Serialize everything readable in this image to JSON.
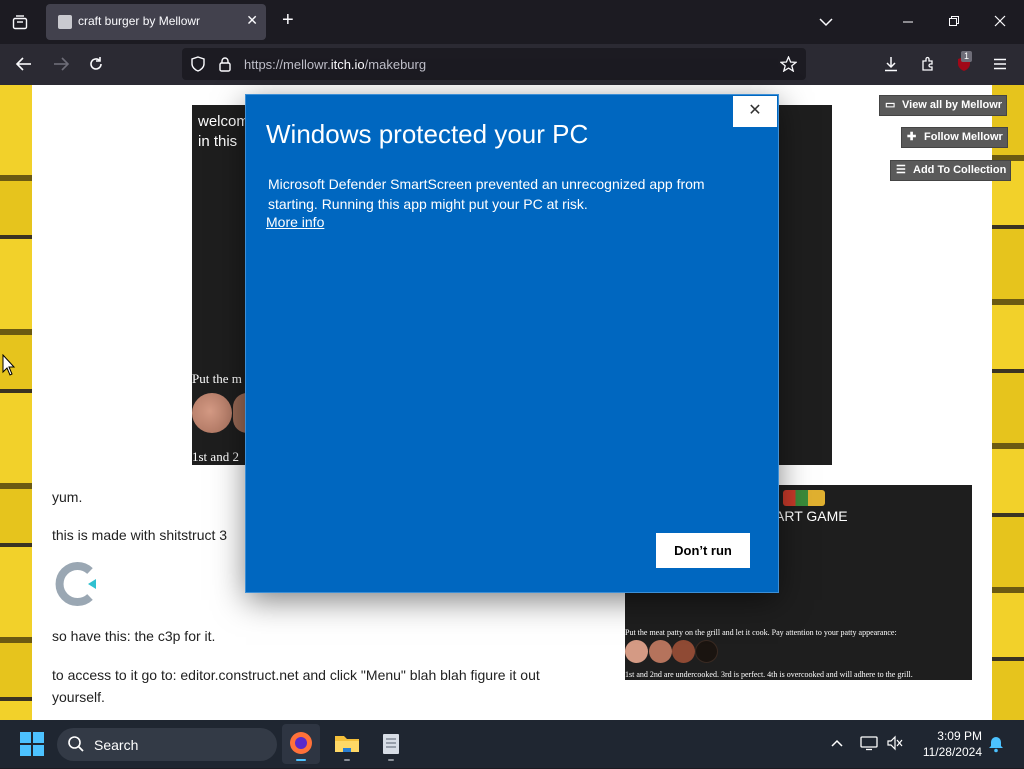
{
  "browser": {
    "tab_title": "craft burger by Mellowr",
    "tab_close": "✕",
    "new_tab": "+",
    "url_prefix": "https://mellowr.",
    "url_domain": "itch.io",
    "url_path": "/makeburg",
    "extension_badge": "1"
  },
  "page": {
    "itch_buttons": [
      "View all by Mellowr",
      "Follow Mellowr",
      "Add To Collection"
    ],
    "game1": {
      "welcome_text": "welcome in this",
      "put_text": "Put the m",
      "first_text": "1st and 2"
    },
    "game2": {
      "title_text": "ART GAME",
      "instruction": "Put the meat patty on the grill and let it cook. Pay attention to your patty appearance:",
      "note": "1st and 2nd are undercooked. 3rd is perfect. 4th is overcooked and will adhere to the grill."
    },
    "paragraphs": {
      "yum": "yum.",
      "made_with": "this is made with shitstruct 3",
      "c3p": "so have this: the c3p for it.",
      "access_line1": "to access to it go to: editor.construct.net and click \"Menu\" blah blah figure it out",
      "access_line2": "yourself."
    }
  },
  "dialog": {
    "title": "Windows protected your PC",
    "body": "Microsoft Defender SmartScreen prevented an unrecognized app from starting. Running this app might put your PC at risk.",
    "more_info": "More info",
    "dont_run": "Don’t run",
    "close": "✕"
  },
  "taskbar": {
    "search_label": "Search",
    "time": "3:09 PM",
    "date": "11/28/2024"
  }
}
